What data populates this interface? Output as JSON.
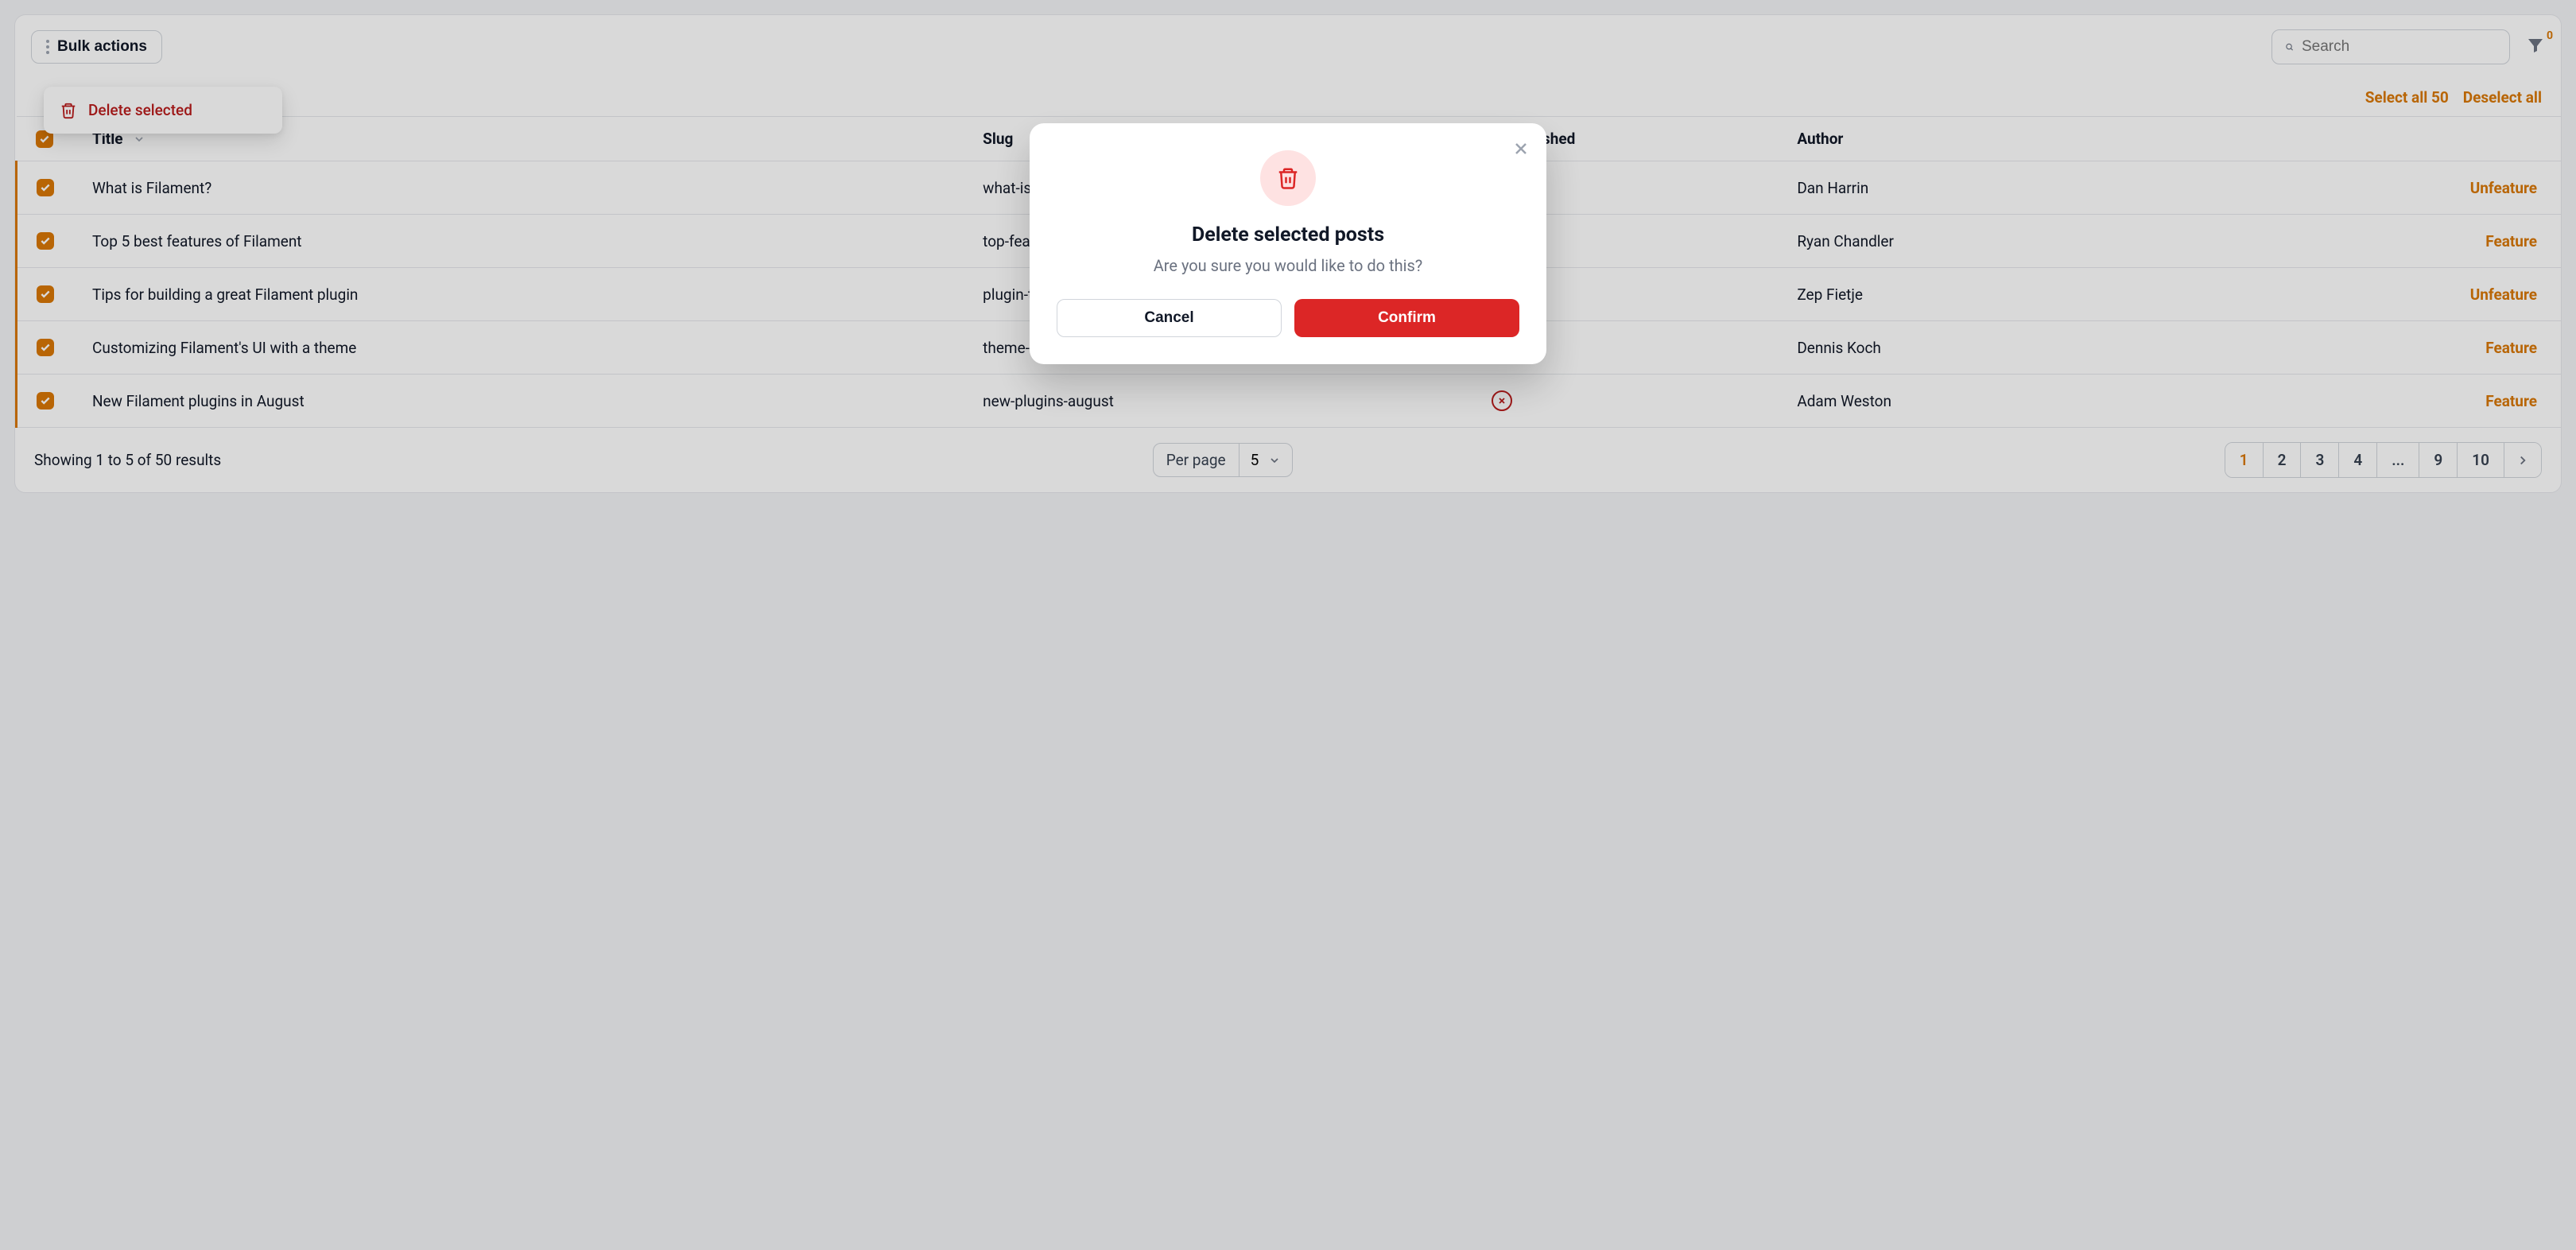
{
  "toolbar": {
    "bulk_actions_label": "Bulk actions",
    "search_placeholder": "Search",
    "filter_badge": "0",
    "dropdown": {
      "delete_selected": "Delete selected"
    }
  },
  "selection_bar": {
    "select_all": "Select all 50",
    "deselect_all": "Deselect all"
  },
  "table": {
    "headers": {
      "title": "Title",
      "slug": "Slug",
      "published": "Is Published",
      "author": "Author"
    },
    "rows": [
      {
        "title": "What is Filament?",
        "slug": "what-is-filament",
        "published": false,
        "author": "Dan Harrin",
        "action": "Unfeature"
      },
      {
        "title": "Top 5 best features of Filament",
        "slug": "top-features",
        "published": false,
        "author": "Ryan Chandler",
        "action": "Feature"
      },
      {
        "title": "Tips for building a great Filament plugin",
        "slug": "plugin-tips",
        "published": false,
        "author": "Zep Fietje",
        "action": "Unfeature"
      },
      {
        "title": "Customizing Filament's UI with a theme",
        "slug": "theme-guide",
        "published": false,
        "author": "Dennis Koch",
        "action": "Feature"
      },
      {
        "title": "New Filament plugins in August",
        "slug": "new-plugins-august",
        "published": false,
        "author": "Adam Weston",
        "action": "Feature"
      }
    ]
  },
  "footer": {
    "summary": "Showing 1 to 5 of 50 results",
    "per_page_label": "Per page",
    "per_page_value": "5"
  },
  "pagination": {
    "pages": [
      "1",
      "2",
      "3",
      "4",
      "...",
      "9",
      "10"
    ],
    "active": "1"
  },
  "modal": {
    "title": "Delete selected posts",
    "subtitle": "Are you sure you would like to do this?",
    "cancel": "Cancel",
    "confirm": "Confirm"
  }
}
